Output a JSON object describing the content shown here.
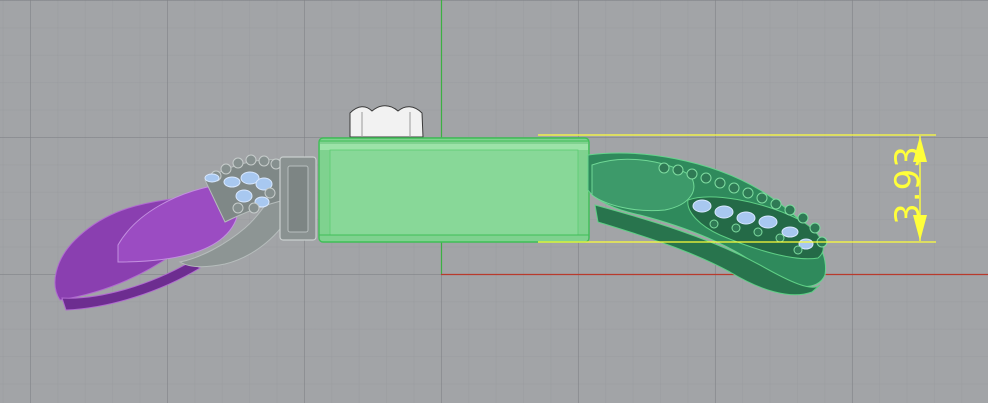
{
  "viewport": {
    "dimension": {
      "value": "3.93"
    }
  },
  "colors": {
    "background": "#a2a4a7",
    "grid": "#84868a",
    "x_axis": "#c0392b",
    "y_axis": "#3cb043",
    "selection": "#7fd68f",
    "purple_part": "#8a3fb0",
    "gray_part": "#8d9594",
    "teal_part": "#2f8a5c",
    "gems": "#a8c8f0",
    "dimension": "#ffff3a"
  }
}
